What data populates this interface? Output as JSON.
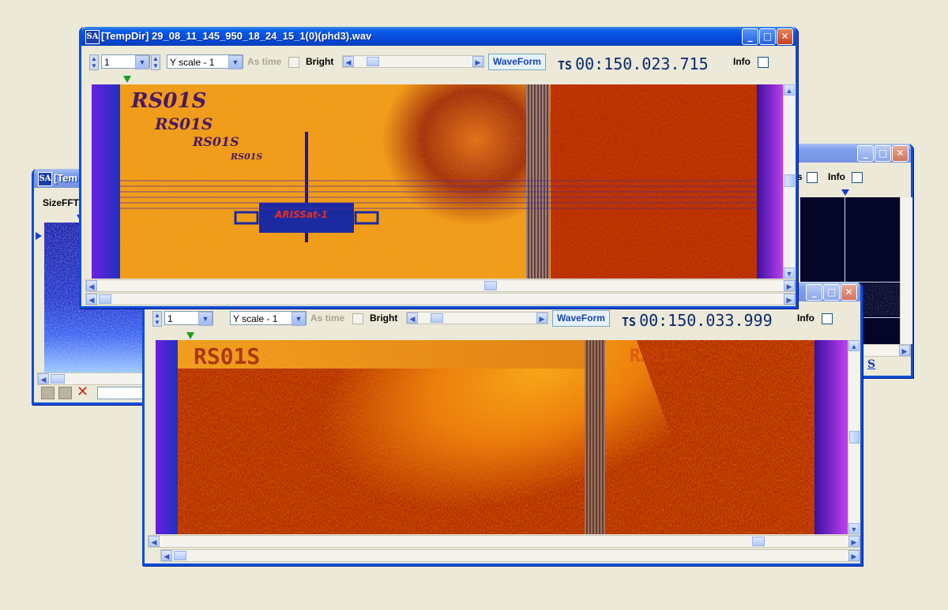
{
  "windows": {
    "back_left": {
      "title": "[Tem",
      "toolbar_label": "SizeFFT"
    },
    "back_right": {
      "partial_label": "s",
      "info_label": "Info",
      "s_button_label": "S"
    },
    "top": {
      "title": "[TempDir] 29_08_11_145_950_18_24_15_1(0)(phd3).wav",
      "channel_value": "1",
      "yscale_value": "Y scale - 1",
      "as_time_label": "As time",
      "bright_label": "Bright",
      "waveform_label": "WaveForm",
      "ts_label": "TS",
      "ts_value": "00:150.023.715",
      "info_label": "Info",
      "image_text": [
        "RS01S",
        "RS01S",
        "RS01S",
        "RS01S",
        "ARISSat-1"
      ]
    },
    "bottom": {
      "channel_value": "1",
      "yscale_value": "Y scale - 1",
      "as_time_label": "As time",
      "bright_label": "Bright",
      "waveform_label": "WaveForm",
      "ts_label": "TS",
      "ts_value": "00:150.033.999",
      "info_label": "Info",
      "image_text": [
        "RS01S",
        "RS01S"
      ]
    }
  },
  "icons": {
    "app": "SA",
    "minimize": "minimize-icon",
    "maximize": "maximize-icon",
    "close": "close-icon"
  },
  "colors": {
    "title_active": "#0548d8",
    "sstv_orange": "#f4a020",
    "sstv_red": "#b82000",
    "sstv_border_purple": "#c030e8",
    "spectrum_blue": "#2c38e0"
  }
}
